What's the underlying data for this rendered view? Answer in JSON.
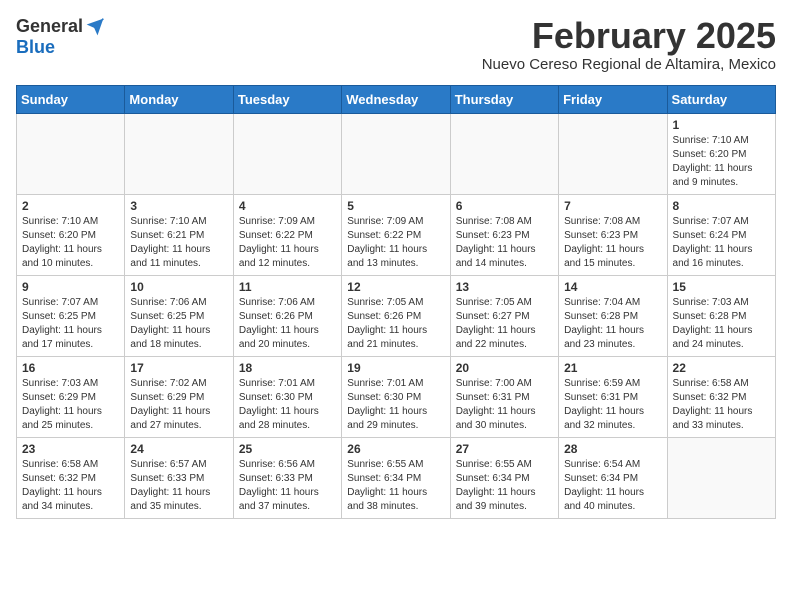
{
  "header": {
    "logo_general": "General",
    "logo_blue": "Blue",
    "month": "February 2025",
    "location": "Nuevo Cereso Regional de Altamira, Mexico"
  },
  "weekdays": [
    "Sunday",
    "Monday",
    "Tuesday",
    "Wednesday",
    "Thursday",
    "Friday",
    "Saturday"
  ],
  "weeks": [
    [
      {
        "day": "",
        "info": ""
      },
      {
        "day": "",
        "info": ""
      },
      {
        "day": "",
        "info": ""
      },
      {
        "day": "",
        "info": ""
      },
      {
        "day": "",
        "info": ""
      },
      {
        "day": "",
        "info": ""
      },
      {
        "day": "1",
        "info": "Sunrise: 7:10 AM\nSunset: 6:20 PM\nDaylight: 11 hours\nand 9 minutes."
      }
    ],
    [
      {
        "day": "2",
        "info": "Sunrise: 7:10 AM\nSunset: 6:20 PM\nDaylight: 11 hours\nand 10 minutes."
      },
      {
        "day": "3",
        "info": "Sunrise: 7:10 AM\nSunset: 6:21 PM\nDaylight: 11 hours\nand 11 minutes."
      },
      {
        "day": "4",
        "info": "Sunrise: 7:09 AM\nSunset: 6:22 PM\nDaylight: 11 hours\nand 12 minutes."
      },
      {
        "day": "5",
        "info": "Sunrise: 7:09 AM\nSunset: 6:22 PM\nDaylight: 11 hours\nand 13 minutes."
      },
      {
        "day": "6",
        "info": "Sunrise: 7:08 AM\nSunset: 6:23 PM\nDaylight: 11 hours\nand 14 minutes."
      },
      {
        "day": "7",
        "info": "Sunrise: 7:08 AM\nSunset: 6:23 PM\nDaylight: 11 hours\nand 15 minutes."
      },
      {
        "day": "8",
        "info": "Sunrise: 7:07 AM\nSunset: 6:24 PM\nDaylight: 11 hours\nand 16 minutes."
      }
    ],
    [
      {
        "day": "9",
        "info": "Sunrise: 7:07 AM\nSunset: 6:25 PM\nDaylight: 11 hours\nand 17 minutes."
      },
      {
        "day": "10",
        "info": "Sunrise: 7:06 AM\nSunset: 6:25 PM\nDaylight: 11 hours\nand 18 minutes."
      },
      {
        "day": "11",
        "info": "Sunrise: 7:06 AM\nSunset: 6:26 PM\nDaylight: 11 hours\nand 20 minutes."
      },
      {
        "day": "12",
        "info": "Sunrise: 7:05 AM\nSunset: 6:26 PM\nDaylight: 11 hours\nand 21 minutes."
      },
      {
        "day": "13",
        "info": "Sunrise: 7:05 AM\nSunset: 6:27 PM\nDaylight: 11 hours\nand 22 minutes."
      },
      {
        "day": "14",
        "info": "Sunrise: 7:04 AM\nSunset: 6:28 PM\nDaylight: 11 hours\nand 23 minutes."
      },
      {
        "day": "15",
        "info": "Sunrise: 7:03 AM\nSunset: 6:28 PM\nDaylight: 11 hours\nand 24 minutes."
      }
    ],
    [
      {
        "day": "16",
        "info": "Sunrise: 7:03 AM\nSunset: 6:29 PM\nDaylight: 11 hours\nand 25 minutes."
      },
      {
        "day": "17",
        "info": "Sunrise: 7:02 AM\nSunset: 6:29 PM\nDaylight: 11 hours\nand 27 minutes."
      },
      {
        "day": "18",
        "info": "Sunrise: 7:01 AM\nSunset: 6:30 PM\nDaylight: 11 hours\nand 28 minutes."
      },
      {
        "day": "19",
        "info": "Sunrise: 7:01 AM\nSunset: 6:30 PM\nDaylight: 11 hours\nand 29 minutes."
      },
      {
        "day": "20",
        "info": "Sunrise: 7:00 AM\nSunset: 6:31 PM\nDaylight: 11 hours\nand 30 minutes."
      },
      {
        "day": "21",
        "info": "Sunrise: 6:59 AM\nSunset: 6:31 PM\nDaylight: 11 hours\nand 32 minutes."
      },
      {
        "day": "22",
        "info": "Sunrise: 6:58 AM\nSunset: 6:32 PM\nDaylight: 11 hours\nand 33 minutes."
      }
    ],
    [
      {
        "day": "23",
        "info": "Sunrise: 6:58 AM\nSunset: 6:32 PM\nDaylight: 11 hours\nand 34 minutes."
      },
      {
        "day": "24",
        "info": "Sunrise: 6:57 AM\nSunset: 6:33 PM\nDaylight: 11 hours\nand 35 minutes."
      },
      {
        "day": "25",
        "info": "Sunrise: 6:56 AM\nSunset: 6:33 PM\nDaylight: 11 hours\nand 37 minutes."
      },
      {
        "day": "26",
        "info": "Sunrise: 6:55 AM\nSunset: 6:34 PM\nDaylight: 11 hours\nand 38 minutes."
      },
      {
        "day": "27",
        "info": "Sunrise: 6:55 AM\nSunset: 6:34 PM\nDaylight: 11 hours\nand 39 minutes."
      },
      {
        "day": "28",
        "info": "Sunrise: 6:54 AM\nSunset: 6:34 PM\nDaylight: 11 hours\nand 40 minutes."
      },
      {
        "day": "",
        "info": ""
      }
    ]
  ]
}
